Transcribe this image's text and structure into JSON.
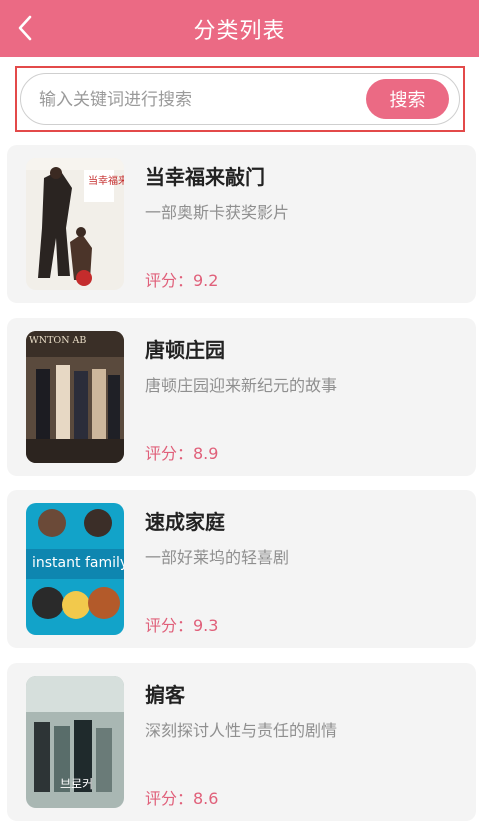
{
  "header": {
    "title": "分类列表",
    "back_icon": "chevron-left-icon"
  },
  "search": {
    "placeholder": "输入关键词进行搜索",
    "value": "",
    "button_label": "搜索"
  },
  "colors": {
    "accent": "#eb6a84",
    "highlight_border": "#e34a4a",
    "card_bg": "#f4f4f4",
    "score_text": "#e0607a"
  },
  "movies": [
    {
      "title": "当幸福来敲门",
      "desc": "一部奥斯卡获奖影片",
      "score": "评分：9.2",
      "poster_text": "当幸福来敲门"
    },
    {
      "title": "唐顿庄园",
      "desc": "唐顿庄园迎来新纪元的故事",
      "score": "评分：8.9",
      "poster_text": "WNTON AB"
    },
    {
      "title": "速成家庭",
      "desc": "一部好莱坞的轻喜剧",
      "score": "评分：9.3",
      "poster_text": "instant family"
    },
    {
      "title": "掮客",
      "desc": "深刻探讨人性与责任的剧情",
      "score": "评分：8.6",
      "poster_text": "브로커"
    }
  ]
}
